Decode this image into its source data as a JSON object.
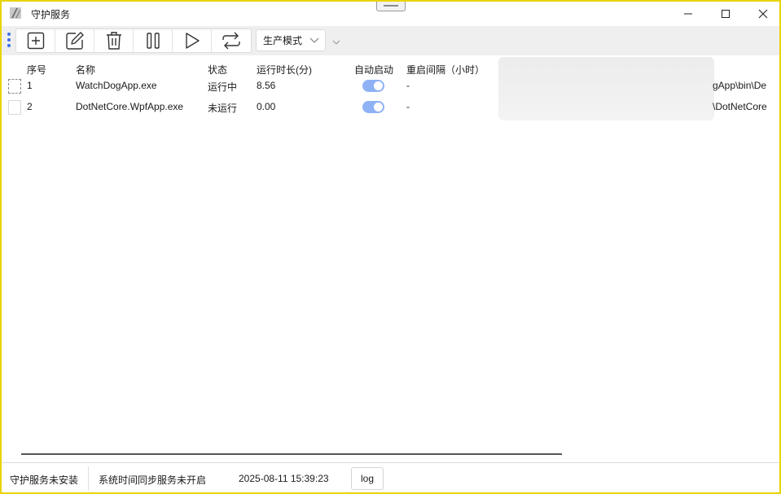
{
  "window": {
    "title": "守护服务"
  },
  "toolbar": {
    "buttons": [
      {
        "icon": "add-icon"
      },
      {
        "icon": "edit-icon"
      },
      {
        "icon": "delete-icon"
      },
      {
        "icon": "pause-icon"
      },
      {
        "icon": "play-icon"
      },
      {
        "icon": "restart-icon"
      }
    ],
    "mode_select": {
      "value": "生产模式"
    }
  },
  "table": {
    "columns": [
      "序号",
      "名称",
      "状态",
      "运行时长(分)",
      "自动启动",
      "重启间隔（小时）"
    ],
    "rows": [
      {
        "index": "1",
        "name": "WatchDogApp.exe",
        "status": "运行中",
        "runtime": "8.56",
        "auto_start": true,
        "restart_interval": "-",
        "path_visible": "gApp\\bin\\De"
      },
      {
        "index": "2",
        "name": "DotNetCore.WpfApp.exe",
        "status": "未运行",
        "runtime": "0.00",
        "auto_start": true,
        "restart_interval": "-",
        "path_visible": "\\DotNetCore"
      }
    ]
  },
  "statusbar": {
    "service_state": "守护服务未安装",
    "time_sync_state": "系统时间同步服务未开启",
    "datetime": "2025-08-11 15:39:23",
    "log_label": "log"
  },
  "colors": {
    "accent": "#3a6ee8",
    "toggle_on": "#8fb2f5",
    "window_border": "#e8d400"
  }
}
